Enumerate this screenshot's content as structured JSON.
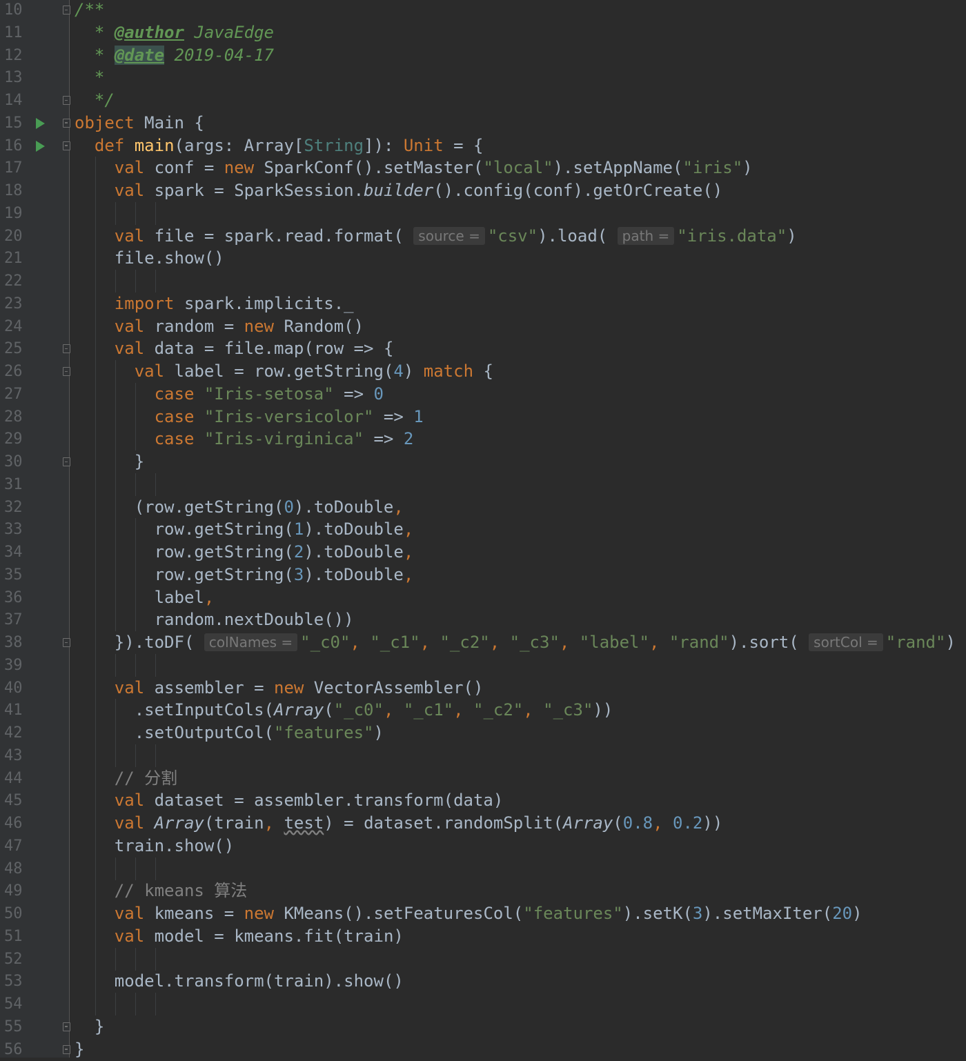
{
  "editor": {
    "line_numbers": [
      "10",
      "11",
      "12",
      "13",
      "14",
      "15",
      "16",
      "17",
      "18",
      "19",
      "20",
      "21",
      "22",
      "23",
      "24",
      "25",
      "26",
      "27",
      "28",
      "29",
      "30",
      "31",
      "32",
      "33",
      "34",
      "35",
      "36",
      "37",
      "38",
      "39",
      "40",
      "41",
      "42",
      "43",
      "44",
      "45",
      "46",
      "47",
      "48",
      "49",
      "50",
      "51",
      "52",
      "53",
      "54",
      "55",
      "56"
    ],
    "run_gutter_lines": [
      "15",
      "16"
    ],
    "fold_marker_lines": [
      "10",
      "14",
      "15",
      "16",
      "25",
      "26",
      "30",
      "38",
      "55",
      "56"
    ],
    "lines": [
      [
        {
          "t": "/**",
          "c": "doc"
        }
      ],
      [
        {
          "t": "  * ",
          "c": "doc"
        },
        {
          "t": "@author",
          "c": "tag"
        },
        {
          "t": " JavaEdge",
          "c": "doc"
        }
      ],
      [
        {
          "t": "  * ",
          "c": "doc"
        },
        {
          "t": "@date",
          "c": "tag taghl"
        },
        {
          "t": " 2019-04-17",
          "c": "doc"
        }
      ],
      [
        {
          "t": "  *",
          "c": "doc"
        }
      ],
      [
        {
          "t": "  */",
          "c": "doc"
        }
      ],
      [
        {
          "t": "object",
          "c": "kw"
        },
        {
          "t": " Main {"
        }
      ],
      [
        {
          "t": "  "
        },
        {
          "t": "def",
          "c": "kw"
        },
        {
          "t": " "
        },
        {
          "t": "main",
          "c": "fn"
        },
        {
          "t": "(args: Array["
        },
        {
          "t": "String",
          "c": "tp"
        },
        {
          "t": "]): "
        },
        {
          "t": "Unit",
          "c": "kw"
        },
        {
          "t": " = {"
        }
      ],
      [
        {
          "t": "    "
        },
        {
          "t": "val",
          "c": "kw"
        },
        {
          "t": " conf = "
        },
        {
          "t": "new",
          "c": "kw"
        },
        {
          "t": " SparkConf().setMaster("
        },
        {
          "t": "\"local\"",
          "c": "str"
        },
        {
          "t": ").setAppName("
        },
        {
          "t": "\"iris\"",
          "c": "str"
        },
        {
          "t": ")"
        }
      ],
      [
        {
          "t": "    "
        },
        {
          "t": "val",
          "c": "kw"
        },
        {
          "t": " spark = SparkSession."
        },
        {
          "t": "builder",
          "c": "it"
        },
        {
          "t": "().config(conf).getOrCreate()"
        }
      ],
      [],
      [
        {
          "t": "    "
        },
        {
          "t": "val",
          "c": "kw"
        },
        {
          "t": " file = spark.read.format( "
        },
        {
          "t": "source =",
          "c": "hint"
        },
        {
          "t": "\"csv\"",
          "c": "str"
        },
        {
          "t": ").load( "
        },
        {
          "t": "path =",
          "c": "hint"
        },
        {
          "t": "\"iris.data\"",
          "c": "str"
        },
        {
          "t": ")"
        }
      ],
      [
        {
          "t": "    file.show()"
        }
      ],
      [],
      [
        {
          "t": "    "
        },
        {
          "t": "import",
          "c": "kw"
        },
        {
          "t": " spark.implicits._"
        }
      ],
      [
        {
          "t": "    "
        },
        {
          "t": "val",
          "c": "kw"
        },
        {
          "t": " random = "
        },
        {
          "t": "new",
          "c": "kw"
        },
        {
          "t": " Random()"
        }
      ],
      [
        {
          "t": "    "
        },
        {
          "t": "val",
          "c": "kw"
        },
        {
          "t": " data = file.map(row => {"
        }
      ],
      [
        {
          "t": "      "
        },
        {
          "t": "val",
          "c": "kw"
        },
        {
          "t": " label = row.getString("
        },
        {
          "t": "4",
          "c": "num"
        },
        {
          "t": ") "
        },
        {
          "t": "match",
          "c": "kw"
        },
        {
          "t": " {"
        }
      ],
      [
        {
          "t": "        "
        },
        {
          "t": "case",
          "c": "kw"
        },
        {
          "t": " "
        },
        {
          "t": "\"Iris-setosa\"",
          "c": "str"
        },
        {
          "t": " => "
        },
        {
          "t": "0",
          "c": "num"
        }
      ],
      [
        {
          "t": "        "
        },
        {
          "t": "case",
          "c": "kw"
        },
        {
          "t": " "
        },
        {
          "t": "\"Iris-versicolor\"",
          "c": "str"
        },
        {
          "t": " => "
        },
        {
          "t": "1",
          "c": "num"
        }
      ],
      [
        {
          "t": "        "
        },
        {
          "t": "case",
          "c": "kw"
        },
        {
          "t": " "
        },
        {
          "t": "\"Iris-virginica\"",
          "c": "str"
        },
        {
          "t": " => "
        },
        {
          "t": "2",
          "c": "num"
        }
      ],
      [
        {
          "t": "      }"
        }
      ],
      [],
      [
        {
          "t": "      (row.getString("
        },
        {
          "t": "0",
          "c": "num"
        },
        {
          "t": ").toDouble"
        },
        {
          "t": ",",
          "c": "kw"
        }
      ],
      [
        {
          "t": "        row.getString("
        },
        {
          "t": "1",
          "c": "num"
        },
        {
          "t": ").toDouble"
        },
        {
          "t": ",",
          "c": "kw"
        }
      ],
      [
        {
          "t": "        row.getString("
        },
        {
          "t": "2",
          "c": "num"
        },
        {
          "t": ").toDouble"
        },
        {
          "t": ",",
          "c": "kw"
        }
      ],
      [
        {
          "t": "        row.getString("
        },
        {
          "t": "3",
          "c": "num"
        },
        {
          "t": ").toDouble"
        },
        {
          "t": ",",
          "c": "kw"
        }
      ],
      [
        {
          "t": "        label"
        },
        {
          "t": ",",
          "c": "kw"
        }
      ],
      [
        {
          "t": "        random.nextDouble())"
        }
      ],
      [
        {
          "t": "    }).toDF( "
        },
        {
          "t": "colNames =",
          "c": "hint"
        },
        {
          "t": "\"_c0\"",
          "c": "str"
        },
        {
          "t": ", ",
          "c": "kw"
        },
        {
          "t": "\"_c1\"",
          "c": "str"
        },
        {
          "t": ", ",
          "c": "kw"
        },
        {
          "t": "\"_c2\"",
          "c": "str"
        },
        {
          "t": ", ",
          "c": "kw"
        },
        {
          "t": "\"_c3\"",
          "c": "str"
        },
        {
          "t": ", ",
          "c": "kw"
        },
        {
          "t": "\"label\"",
          "c": "str"
        },
        {
          "t": ", ",
          "c": "kw"
        },
        {
          "t": "\"rand\"",
          "c": "str"
        },
        {
          "t": ").sort( "
        },
        {
          "t": "sortCol =",
          "c": "hint"
        },
        {
          "t": "\"rand\"",
          "c": "str"
        },
        {
          "t": ")"
        }
      ],
      [],
      [
        {
          "t": "    "
        },
        {
          "t": "val",
          "c": "kw"
        },
        {
          "t": " assembler = "
        },
        {
          "t": "new",
          "c": "kw"
        },
        {
          "t": " VectorAssembler()"
        }
      ],
      [
        {
          "t": "      .setInputCols("
        },
        {
          "t": "Array",
          "c": "it"
        },
        {
          "t": "("
        },
        {
          "t": "\"_c0\"",
          "c": "str"
        },
        {
          "t": ", ",
          "c": "kw"
        },
        {
          "t": "\"_c1\"",
          "c": "str"
        },
        {
          "t": ", ",
          "c": "kw"
        },
        {
          "t": "\"_c2\"",
          "c": "str"
        },
        {
          "t": ", ",
          "c": "kw"
        },
        {
          "t": "\"_c3\"",
          "c": "str"
        },
        {
          "t": "))"
        }
      ],
      [
        {
          "t": "      .setOutputCol("
        },
        {
          "t": "\"features\"",
          "c": "str"
        },
        {
          "t": ")"
        }
      ],
      [],
      [
        {
          "t": "    "
        },
        {
          "t": "// 分割",
          "c": "cmt"
        }
      ],
      [
        {
          "t": "    "
        },
        {
          "t": "val",
          "c": "kw"
        },
        {
          "t": " dataset = assembler.transform(data)"
        }
      ],
      [
        {
          "t": "    "
        },
        {
          "t": "val",
          "c": "kw"
        },
        {
          "t": " "
        },
        {
          "t": "Array",
          "c": "it"
        },
        {
          "t": "(train"
        },
        {
          "t": ", ",
          "c": "kw"
        },
        {
          "t": "test",
          "c": "wavy"
        },
        {
          "t": ") = dataset.randomSplit("
        },
        {
          "t": "Array",
          "c": "it"
        },
        {
          "t": "("
        },
        {
          "t": "0.8",
          "c": "num"
        },
        {
          "t": ", ",
          "c": "kw"
        },
        {
          "t": "0.2",
          "c": "num"
        },
        {
          "t": "))"
        }
      ],
      [
        {
          "t": "    train.show()"
        }
      ],
      [],
      [
        {
          "t": "    "
        },
        {
          "t": "// kmeans 算法",
          "c": "cmt"
        }
      ],
      [
        {
          "t": "    "
        },
        {
          "t": "val",
          "c": "kw"
        },
        {
          "t": " kmeans = "
        },
        {
          "t": "new",
          "c": "kw"
        },
        {
          "t": " KMeans().setFeaturesCol("
        },
        {
          "t": "\"features\"",
          "c": "str"
        },
        {
          "t": ").setK("
        },
        {
          "t": "3",
          "c": "num"
        },
        {
          "t": ").setMaxIter("
        },
        {
          "t": "20",
          "c": "num"
        },
        {
          "t": ")"
        }
      ],
      [
        {
          "t": "    "
        },
        {
          "t": "val",
          "c": "kw"
        },
        {
          "t": " model = kmeans.fit(train)"
        }
      ],
      [],
      [
        {
          "t": "    model.transform(train).show()"
        }
      ],
      [],
      [
        {
          "t": "  }"
        }
      ],
      [
        {
          "t": "}"
        }
      ]
    ]
  }
}
